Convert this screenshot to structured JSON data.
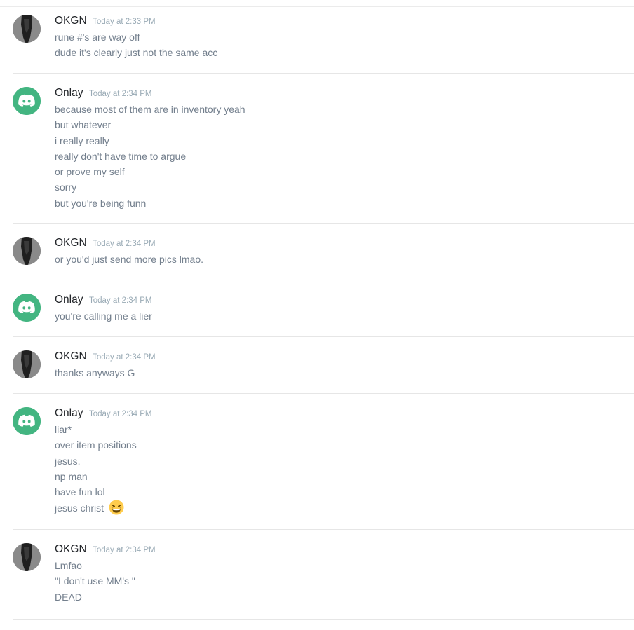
{
  "messages": [
    {
      "author": "OKGN",
      "avatar_icon": "dark-photo-avatar",
      "timestamp": "Today at 2:33 PM",
      "lines": [
        "rune #'s are way off",
        "dude it's clearly just not the same acc"
      ]
    },
    {
      "author": "Onlay",
      "avatar_icon": "discord-logo-avatar",
      "timestamp": "Today at 2:34 PM",
      "lines": [
        "because most of them are in inventory yeah",
        "but whatever",
        "i really really",
        "really don't have time to argue",
        "or prove my self",
        "sorry",
        "but you're being funn"
      ]
    },
    {
      "author": "OKGN",
      "avatar_icon": "dark-photo-avatar",
      "timestamp": "Today at 2:34 PM",
      "lines": [
        "or you'd just send more pics lmao."
      ]
    },
    {
      "author": "Onlay",
      "avatar_icon": "discord-logo-avatar",
      "timestamp": "Today at 2:34 PM",
      "lines": [
        "you're calling me a lier"
      ]
    },
    {
      "author": "OKGN",
      "avatar_icon": "dark-photo-avatar",
      "timestamp": "Today at 2:34 PM",
      "lines": [
        "thanks anyways G"
      ]
    },
    {
      "author": "Onlay",
      "avatar_icon": "discord-logo-avatar",
      "timestamp": "Today at 2:34 PM",
      "lines": [
        "liar*",
        "over item positions",
        "jesus.",
        "np man",
        "have fun lol",
        "jesus christ"
      ],
      "emoji": "grinning-squinting-face-emoji"
    },
    {
      "author": "OKGN",
      "avatar_icon": "dark-photo-avatar",
      "timestamp": "Today at 2:34 PM",
      "lines": [
        "Lmfao",
        "\"I don't use MM's \"",
        "DEAD"
      ]
    }
  ],
  "colors": {
    "username": "#23262a",
    "message_text": "#737f8d",
    "timestamp": "#99aab5",
    "discord_green": "#43b581",
    "separator": "#e6e6e6"
  }
}
